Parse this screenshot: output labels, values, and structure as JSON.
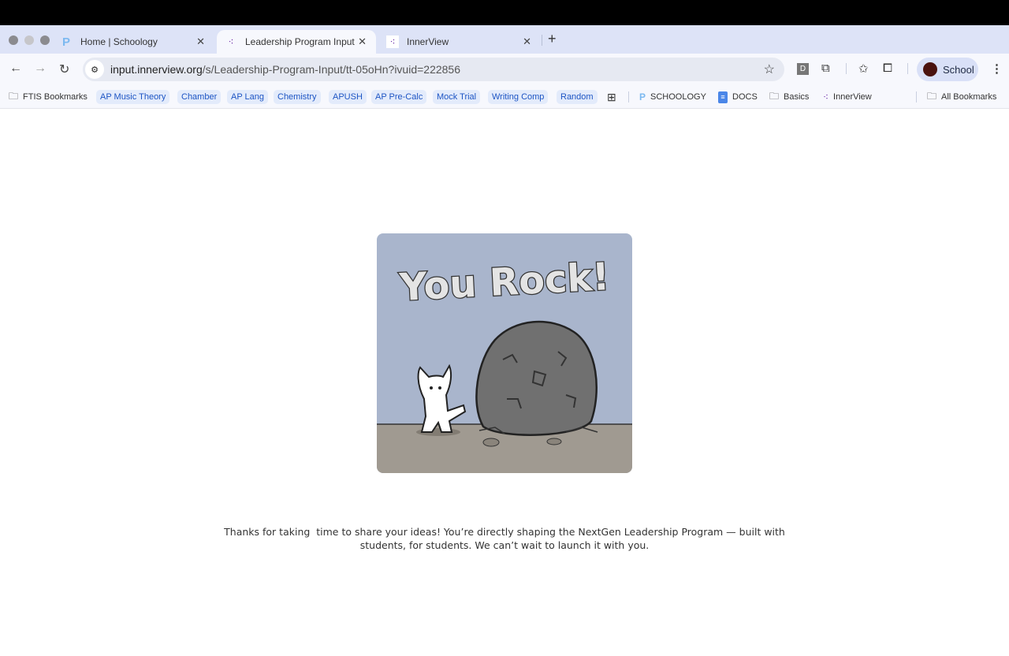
{
  "browser": {
    "tabs": [
      {
        "title": "Home | Schoology",
        "icon": "schoology-icon",
        "active": false
      },
      {
        "title": "Leadership Program Input",
        "icon": "innerview-icon",
        "active": true
      },
      {
        "title": "InnerView",
        "icon": "innerview-icon",
        "active": false
      }
    ],
    "new_tab": "+",
    "close": "✕",
    "url_host": "input.innerview.org",
    "url_path": "/s/Leadership-Program-Input/tt-05oHn?ivuid=222856",
    "extension_letter": "D",
    "profile_name": "School",
    "profile_color": "#4a120e",
    "bookmarks": [
      {
        "label": "FTIS Bookmarks",
        "type": "folder"
      },
      {
        "label": "AP Music Theory",
        "type": "chip"
      },
      {
        "label": "Chamber",
        "type": "chip"
      },
      {
        "label": "AP Lang",
        "type": "chip"
      },
      {
        "label": "Chemistry",
        "type": "chip"
      },
      {
        "label": "APUSH",
        "type": "chip"
      },
      {
        "label": "AP Pre-Calc",
        "type": "chip"
      },
      {
        "label": "Mock Trial",
        "type": "chip"
      },
      {
        "label": "Writing Comp",
        "type": "chip"
      },
      {
        "label": "Random",
        "type": "chip"
      },
      {
        "label": "SCHOOLOGY",
        "type": "link"
      },
      {
        "label": "DOCS",
        "type": "link"
      },
      {
        "label": "Basics",
        "type": "folder"
      },
      {
        "label": "InnerView",
        "type": "link"
      }
    ],
    "all_bookmarks": "All Bookmarks"
  },
  "page": {
    "image_lettering": "You Rock!",
    "message_line1": "Thanks for taking  time to share your ideas! You’re directly shaping the NextGen Leadership Program — built with",
    "message_line2": "students, for students. We can’t wait to launch it with you.",
    "colors": {
      "sky": "#a9b5cc",
      "ground": "#a09a91",
      "rock": "#707070"
    }
  }
}
